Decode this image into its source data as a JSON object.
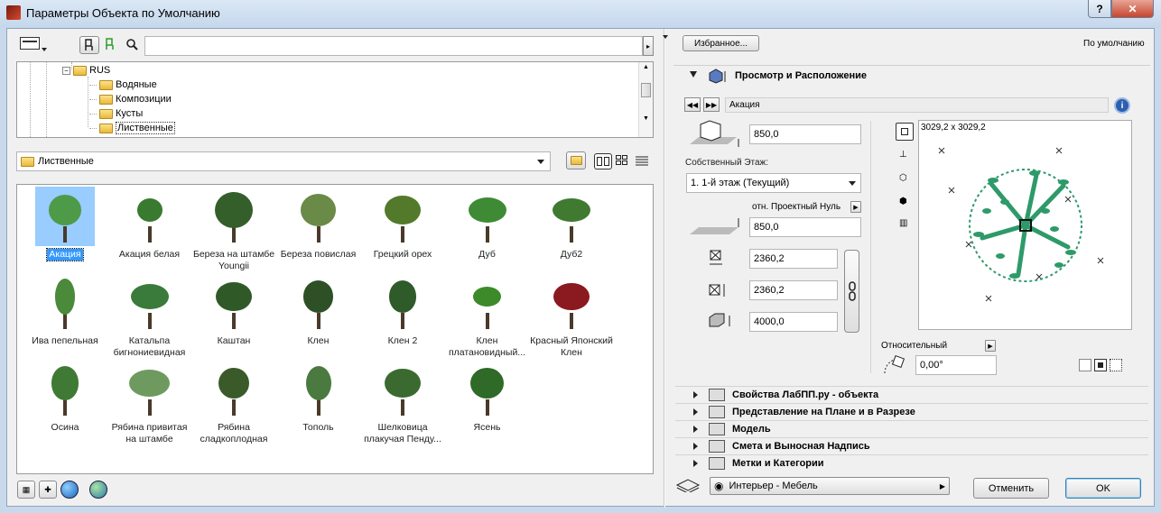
{
  "window": {
    "title": "Параметры Объекта по Умолчанию",
    "help": "?",
    "close": "✕"
  },
  "toolbar": {
    "search_value": ""
  },
  "tree": {
    "root": "RUS",
    "items": [
      "Водяные",
      "Композиции",
      "Кусты",
      "Лиственные"
    ],
    "selected": "Лиственные"
  },
  "folder_select": {
    "value": "Лиственные"
  },
  "objects": [
    {
      "label": "Акация",
      "selected": true
    },
    {
      "label": "Акация белая"
    },
    {
      "label": "Береза на штамбе Youngii"
    },
    {
      "label": "Береза повислая"
    },
    {
      "label": "Грецкий орех"
    },
    {
      "label": "Дуб"
    },
    {
      "label": "Дуб2"
    },
    {
      "label": "Ива пепельная"
    },
    {
      "label": "Катальпа бигнониевидная"
    },
    {
      "label": "Каштан"
    },
    {
      "label": "Клен"
    },
    {
      "label": "Клен 2"
    },
    {
      "label": "Клен платановидный..."
    },
    {
      "label": "Красный Японский Клен"
    },
    {
      "label": "Осина"
    },
    {
      "label": "Рябина привитая на штамбе"
    },
    {
      "label": "Рябина сладкоплодная"
    },
    {
      "label": "Тополь"
    },
    {
      "label": "Шелковица плакучая Пенду..."
    },
    {
      "label": "Ясень"
    }
  ],
  "right": {
    "favorites": "Избранное...",
    "defaults": "По умолчанию",
    "section_title": "Просмотр и Расположение",
    "object_name": "Акация",
    "info": "i",
    "height_top": "850,0",
    "story_label": "Собственный Этаж:",
    "story_value": "1. 1-й этаж (Текущий)",
    "ref_label": "отн. Проектный Нуль",
    "elevation": "850,0",
    "width": "2360,2",
    "depth": "2360,2",
    "height": "4000,0",
    "preview_size": "3029,2 x 3029,2",
    "relative_label": "Относительный",
    "angle": "0,00°",
    "sections": [
      "Свойства ЛабПП.ру - объекта",
      "Представление на Плане и в Разрезе",
      "Модель",
      "Смета и Выносная Надпись",
      "Метки и Категории"
    ],
    "layer": "Интерьер - Мебель",
    "cancel": "Отменить",
    "ok": "OK"
  },
  "colors": {
    "accent": "#3399ff",
    "plan_green": "#2e9a6a",
    "title_bg": "#c4d7ec"
  }
}
